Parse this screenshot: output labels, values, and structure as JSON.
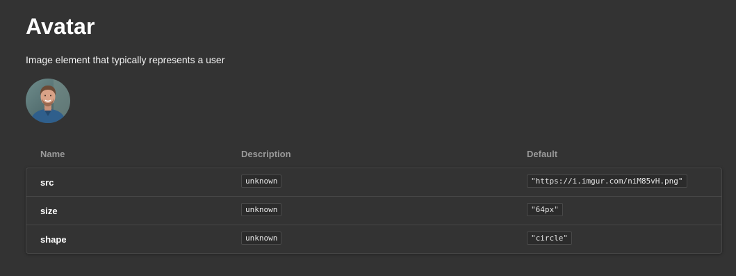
{
  "page": {
    "title": "Avatar",
    "description": "Image element that typically represents a user"
  },
  "avatar": {
    "alt": "user avatar photo"
  },
  "props_table": {
    "headers": {
      "name": "Name",
      "description": "Description",
      "default": "Default"
    },
    "rows": [
      {
        "name": "src",
        "description": "unknown",
        "default": "\"https://i.imgur.com/niM85vH.png\""
      },
      {
        "name": "size",
        "description": "unknown",
        "default": "\"64px\""
      },
      {
        "name": "shape",
        "description": "unknown",
        "default": "\"circle\""
      }
    ]
  },
  "colors": {
    "background": "#333333",
    "text": "#ffffff",
    "header_text": "#9a9a9a",
    "border": "#474747",
    "code_background": "#2b2b2b"
  }
}
